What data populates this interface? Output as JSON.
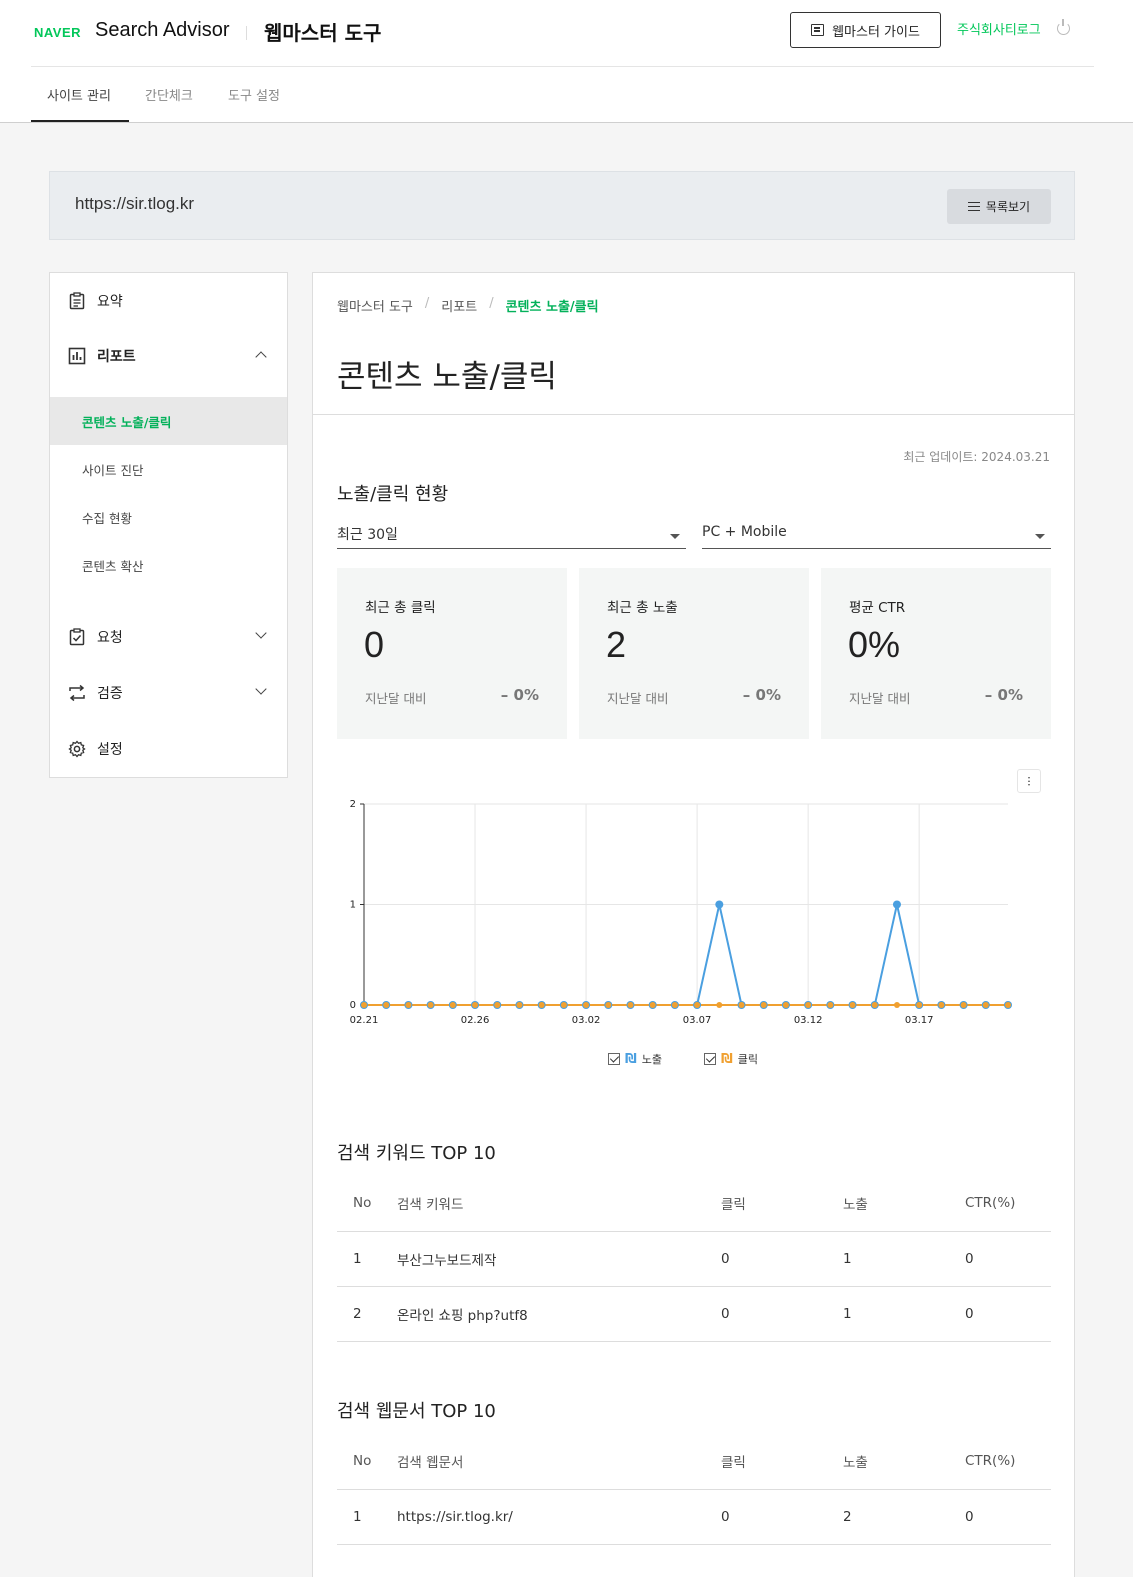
{
  "header": {
    "logo": "NAVER",
    "brand": "Search Advisor",
    "tool_title": "웹마스터 도구",
    "guide_label": "웹마스터 가이드",
    "user": "주식회사티로그"
  },
  "tabs": [
    {
      "label": "사이트 관리",
      "active": true
    },
    {
      "label": "간단체크",
      "active": false
    },
    {
      "label": "도구 설정",
      "active": false
    }
  ],
  "site": {
    "url": "https://sir.tlog.kr",
    "list_button": "목록보기"
  },
  "sidebar": {
    "summary": "요약",
    "report": "리포트",
    "report_items": [
      "콘텐츠 노출/클릭",
      "사이트 진단",
      "수집 현황",
      "콘텐츠 확산"
    ],
    "request": "요청",
    "verify": "검증",
    "settings": "설정"
  },
  "breadcrumb": [
    "웹마스터 도구",
    "리포트",
    "콘텐츠 노출/클릭"
  ],
  "page_title": "콘텐츠 노출/클릭",
  "updated": "최근 업데이트: 2024.03.21",
  "overview": {
    "title": "노출/클릭 현황",
    "period": "최근 30일",
    "device": "PC + Mobile"
  },
  "stats": [
    {
      "label": "최근 총 클릭",
      "value": "0",
      "compare": "지난달 대비",
      "change": "– 0%"
    },
    {
      "label": "최근 총 노출",
      "value": "2",
      "compare": "지난달 대비",
      "change": "– 0%"
    },
    {
      "label": "평균 CTR",
      "value": "0%",
      "compare": "지난달 대비",
      "change": "– 0%"
    }
  ],
  "chart_data": {
    "type": "line",
    "x": [
      "02.21",
      "02.22",
      "02.23",
      "02.24",
      "02.25",
      "02.26",
      "02.27",
      "02.28",
      "02.29",
      "03.01",
      "03.02",
      "03.03",
      "03.04",
      "03.05",
      "03.06",
      "03.07",
      "03.08",
      "03.09",
      "03.10",
      "03.11",
      "03.12",
      "03.13",
      "03.14",
      "03.15",
      "03.16",
      "03.17",
      "03.18",
      "03.19",
      "03.20",
      "03.21"
    ],
    "xticks": [
      "02.21",
      "02.26",
      "03.02",
      "03.07",
      "03.12",
      "03.17"
    ],
    "ylim": [
      0,
      2
    ],
    "yticks": [
      0,
      1,
      2
    ],
    "grid": true,
    "series": [
      {
        "name": "노출",
        "color": "#4a9fe0",
        "values": [
          0,
          0,
          0,
          0,
          0,
          0,
          0,
          0,
          0,
          0,
          0,
          0,
          0,
          0,
          0,
          0,
          1,
          0,
          0,
          0,
          0,
          0,
          0,
          0,
          1,
          0,
          0,
          0,
          0,
          0
        ]
      },
      {
        "name": "클릭",
        "color": "#f0a030",
        "values": [
          0,
          0,
          0,
          0,
          0,
          0,
          0,
          0,
          0,
          0,
          0,
          0,
          0,
          0,
          0,
          0,
          0,
          0,
          0,
          0,
          0,
          0,
          0,
          0,
          0,
          0,
          0,
          0,
          0,
          0
        ]
      }
    ]
  },
  "keywords": {
    "title": "검색 키워드 TOP 10",
    "headers": [
      "No",
      "검색 키워드",
      "클릭",
      "노출",
      "CTR(%)"
    ],
    "rows": [
      [
        "1",
        "부산그누보드제작",
        "0",
        "1",
        "0"
      ],
      [
        "2",
        "온라인 쇼핑 php?utf8",
        "0",
        "1",
        "0"
      ]
    ]
  },
  "webdocs": {
    "title": "검색 웹문서 TOP 10",
    "headers": [
      "No",
      "검색 웹문서",
      "클릭",
      "노출",
      "CTR(%)"
    ],
    "rows": [
      [
        "1",
        "https://sir.tlog.kr/",
        "0",
        "2",
        "0"
      ]
    ]
  }
}
